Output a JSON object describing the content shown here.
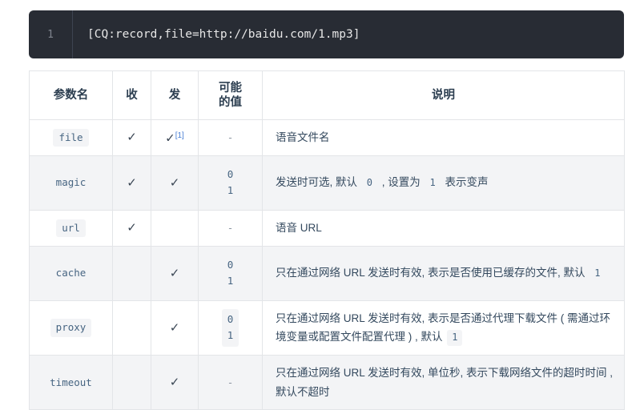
{
  "code_block": {
    "line_number": "1",
    "code": "[CQ:record,file=http://baidu.com/1.mp3]",
    "background": "#282c34"
  },
  "table": {
    "headers": [
      "参数名",
      "收",
      "发",
      "可能\n的值",
      "说明"
    ],
    "header_name": "参数名",
    "header_recv": "收",
    "header_send": "发",
    "header_values_line1": "可能",
    "header_values_line2": "的值",
    "header_desc": "说明",
    "check_glyph": "✓",
    "dash": "-",
    "footnote_marker": "[1]",
    "rows": [
      {
        "name": "file",
        "recv": "✓",
        "send": "✓",
        "send_footnote": "[1]",
        "values": [
          "-"
        ],
        "values_is_dash": true,
        "desc_parts": [
          {
            "t": "语音文件名",
            "code": false
          }
        ]
      },
      {
        "name": "magic",
        "recv": "✓",
        "send": "✓",
        "values": [
          "0",
          "1"
        ],
        "values_is_dash": false,
        "desc_parts": [
          {
            "t": "发送时可选, 默认 ",
            "code": false
          },
          {
            "t": "0",
            "code": true
          },
          {
            "t": " , 设置为 ",
            "code": false
          },
          {
            "t": "1",
            "code": true
          },
          {
            "t": " 表示变声",
            "code": false
          }
        ]
      },
      {
        "name": "url",
        "recv": "✓",
        "send": "",
        "values": [
          "-"
        ],
        "values_is_dash": true,
        "desc_parts": [
          {
            "t": "语音 URL",
            "code": false
          }
        ]
      },
      {
        "name": "cache",
        "recv": "",
        "send": "✓",
        "values": [
          "0",
          "1"
        ],
        "values_is_dash": false,
        "desc_parts": [
          {
            "t": "只在通过网络 URL 发送时有效, 表示是否使用已缓存的文件, 默认 ",
            "code": false
          },
          {
            "t": "1",
            "code": true
          }
        ]
      },
      {
        "name": "proxy",
        "recv": "",
        "send": "✓",
        "values": [
          "0",
          "1"
        ],
        "values_is_dash": false,
        "desc_parts": [
          {
            "t": "只在通过网络 URL 发送时有效, 表示是否通过代理下载文件 ( 需通过环境变量或配置文件配置代理 ) , 默认 ",
            "code": false
          },
          {
            "t": "1",
            "code": true
          }
        ]
      },
      {
        "name": "timeout",
        "recv": "",
        "send": "✓",
        "values": [
          "-"
        ],
        "values_is_dash": true,
        "desc_parts": [
          {
            "t": "只在通过网络 URL 发送时有效, 单位秒, 表示下载网络文件的超时时间 , 默认不超时",
            "code": false
          }
        ]
      }
    ]
  },
  "colors": {
    "code_bg": "#282c34",
    "chip_bg": "#f3f4f6",
    "chip_fg": "#476582",
    "row_alt_bg": "#f3f4f6",
    "border": "#e3e5e8",
    "text": "#2c3e50",
    "link": "#4a7fd4"
  }
}
